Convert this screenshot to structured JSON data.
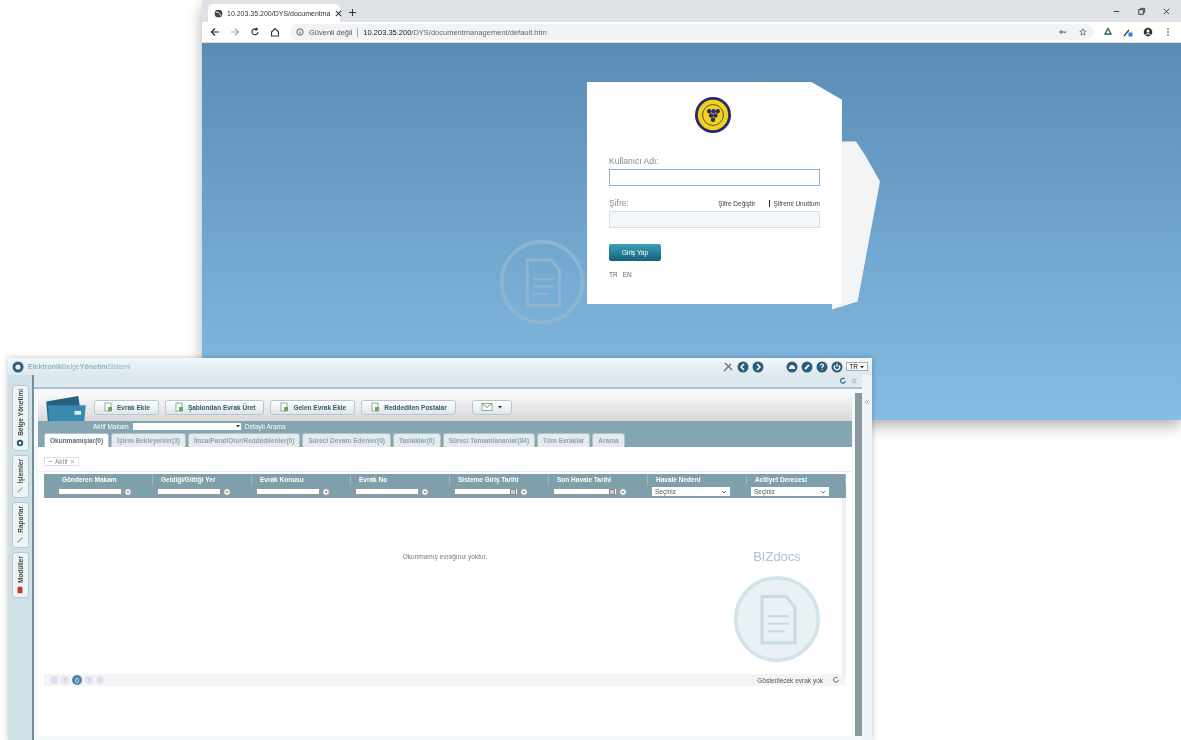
{
  "browser": {
    "tab_title": "10.203.35.200/DYS/documentma",
    "security": "Güvenli değil",
    "url_host": "10.203.35.200",
    "url_path": "/DYS/documentmanagement/default.htm"
  },
  "login": {
    "username_label": "Kullanıcı Adı:",
    "password_label": "Şifre:",
    "change_password": "Şifre Değiştir",
    "forgot_password": "Şifremi Unuttum",
    "submit": "Giriş Yap",
    "languages": [
      {
        "label": "TR"
      },
      {
        "label": "EN"
      }
    ]
  },
  "app": {
    "title": "**Elektronik**Belge**Yönetim**Sistemi",
    "language": "TR",
    "side_tabs": [
      {
        "label": "Belge Yönetimi",
        "kind": "gear"
      },
      {
        "label": "İşlemler",
        "kind": "pen"
      },
      {
        "label": "Raporlar",
        "kind": "pen"
      },
      {
        "label": "Modüller",
        "kind": "book"
      }
    ],
    "toolbar": [
      "Evrak Ekle",
      "Şablondan Evrak Üret",
      "Gelen Evrak Ekle",
      "Reddedilen Postalar"
    ],
    "active_role_label": "Aktif Makam",
    "detailed_search": "Detaylı Arama",
    "tabs": [
      {
        "label": "Okunmamışlar(0)",
        "selected": true
      },
      {
        "label": "İşlem Bekleyenler(3)",
        "selected": false
      },
      {
        "label": "İmza/Paraf/Olur/Reddedilenler(0)",
        "selected": false
      },
      {
        "label": "Süreci Devam Edenler(0)",
        "selected": false
      },
      {
        "label": "Taslaklar(0)",
        "selected": false
      },
      {
        "label": "Süreci Tamamlananlar(84)",
        "selected": false
      },
      {
        "label": "Tüm Evraklar",
        "selected": false
      },
      {
        "label": "Arama",
        "selected": false
      }
    ],
    "filter_chip": "Aktif",
    "columns": [
      {
        "label": "Gönderen Makam",
        "kind": "text"
      },
      {
        "label": "Geldiği/Gittiği Yer",
        "kind": "text"
      },
      {
        "label": "Evrak Konusu",
        "kind": "text"
      },
      {
        "label": "Evrak No",
        "kind": "text"
      },
      {
        "label": "Sisteme Giriş Tarihi",
        "kind": "date"
      },
      {
        "label": "Son Havale Tarihi",
        "kind": "date"
      },
      {
        "label": "Havale Nedeni",
        "kind": "select",
        "value": "Seçiniz"
      },
      {
        "label": "Aciliyet Derecesi",
        "kind": "select",
        "value": "Seçiniz"
      }
    ],
    "empty_message": "Okunmamış evrağınız yoktur.",
    "brand_mark": "BIZdocs",
    "pager_page": "0",
    "pager_status": "Gösterilecek evrak yok"
  }
}
